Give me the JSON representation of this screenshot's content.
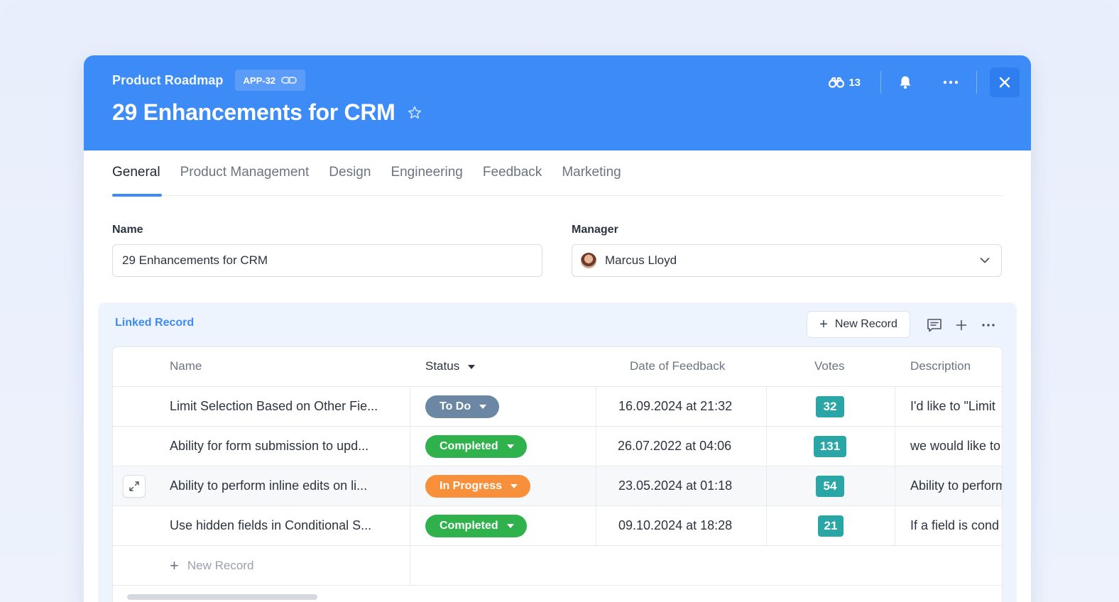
{
  "header": {
    "project": "Product Roadmap",
    "app_id": "APP-32",
    "title": "29 Enhancements for CRM",
    "watchers_count": "13",
    "color": "#3d8bf7"
  },
  "tabs": [
    {
      "label": "General",
      "active": true
    },
    {
      "label": "Product Management"
    },
    {
      "label": "Design"
    },
    {
      "label": "Engineering"
    },
    {
      "label": "Feedback"
    },
    {
      "label": "Marketing"
    }
  ],
  "form": {
    "name_label": "Name",
    "name_value": "29 Enhancements for CRM",
    "manager_label": "Manager",
    "manager_value": "Marcus Lloyd"
  },
  "linked": {
    "title": "Linked Record",
    "new_record_label": "New Record",
    "columns": [
      "Name",
      "Status",
      "Date of Feedback",
      "Votes",
      "Description"
    ],
    "rows": [
      {
        "name": "Limit Selection Based on Other Fie...",
        "status": "To Do",
        "status_color": "#6b87a4",
        "date": "16.09.2024 at 21:32",
        "votes": "32",
        "description": "I'd like to \"Limit"
      },
      {
        "name": "Ability for form submission to upd...",
        "status": "Completed",
        "status_color": "#2fb24c",
        "date": "26.07.2022 at 04:06",
        "votes": "131",
        "description": "we would like to"
      },
      {
        "name": "Ability to perform inline edits on li...",
        "status": "In Progress",
        "status_color": "#f78f3b",
        "date": "23.05.2024 at 01:18",
        "votes": "54",
        "description": "Ability to perform"
      },
      {
        "name": "Use hidden fields in Conditional S...",
        "status": "Completed",
        "status_color": "#2fb24c",
        "date": "09.10.2024 at 18:28",
        "votes": "21",
        "description": "If a field is cond"
      }
    ],
    "add_row_label": "New Record"
  }
}
